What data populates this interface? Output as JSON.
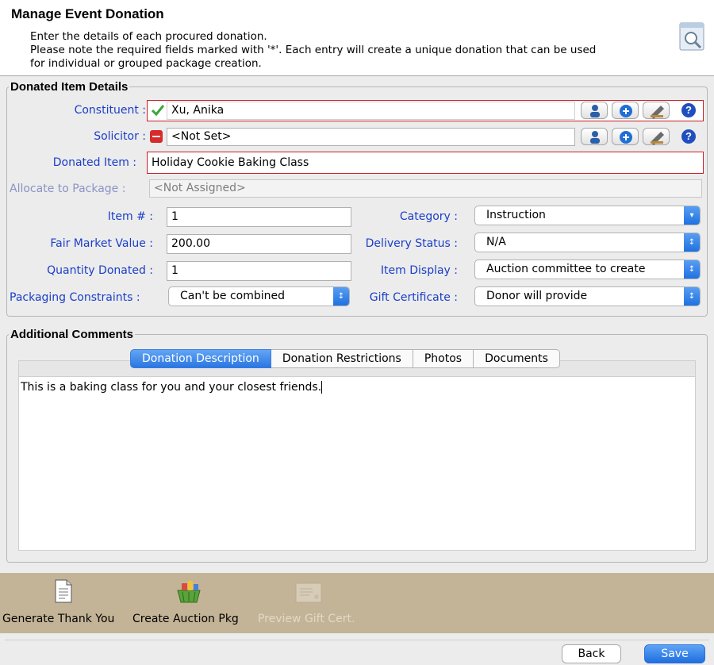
{
  "header": {
    "title": "Manage Event Donation",
    "line1": "Enter the details of each procured donation.",
    "line2": "Please note the required fields marked with '*'. Each entry will create a unique donation that can be used",
    "line3": "for individual or grouped package creation."
  },
  "donated_item_details": {
    "legend": "Donated Item Details",
    "constituent": {
      "label": "Constituent :",
      "value": "Xu, Anika"
    },
    "solicitor": {
      "label": "Solicitor :",
      "value": "<Not Set>"
    },
    "donated_item": {
      "label": "Donated Item :",
      "value": "Holiday Cookie Baking Class"
    },
    "allocate": {
      "label": "Allocate to Package :",
      "value": "<Not Assigned>"
    },
    "item_no": {
      "label": "Item # :",
      "value": "1"
    },
    "fair_market_value": {
      "label": "Fair Market Value :",
      "value": "200.00"
    },
    "quantity_donated": {
      "label": "Quantity Donated :",
      "value": "1"
    },
    "packaging_constraints": {
      "label": "Packaging Constraints :",
      "value": "Can't be combined"
    },
    "category": {
      "label": "Category :",
      "value": "Instruction"
    },
    "delivery_status": {
      "label": "Delivery Status :",
      "value": "N/A"
    },
    "item_display": {
      "label": "Item Display :",
      "value": "Auction committee to create"
    },
    "gift_certificate": {
      "label": "Gift Certificate :",
      "value": "Donor will provide"
    },
    "help_glyph": "?"
  },
  "additional_comments": {
    "legend": "Additional Comments",
    "tabs": [
      "Donation Description",
      "Donation Restrictions",
      "Photos",
      "Documents"
    ],
    "active_tab": 0,
    "text": "This is a baking class for you and your closest friends."
  },
  "toolbar": {
    "thank_you": "Generate Thank You",
    "auction_pkg": "Create Auction Pkg",
    "preview_gift": "Preview Gift Cert."
  },
  "footer": {
    "back": "Back",
    "save": "Save"
  },
  "colors": {
    "label_blue": "#1a3ec9",
    "required_red": "#c9202a",
    "accent_blue": "#2a76e2",
    "toolbar_tan": "#c4b497"
  }
}
